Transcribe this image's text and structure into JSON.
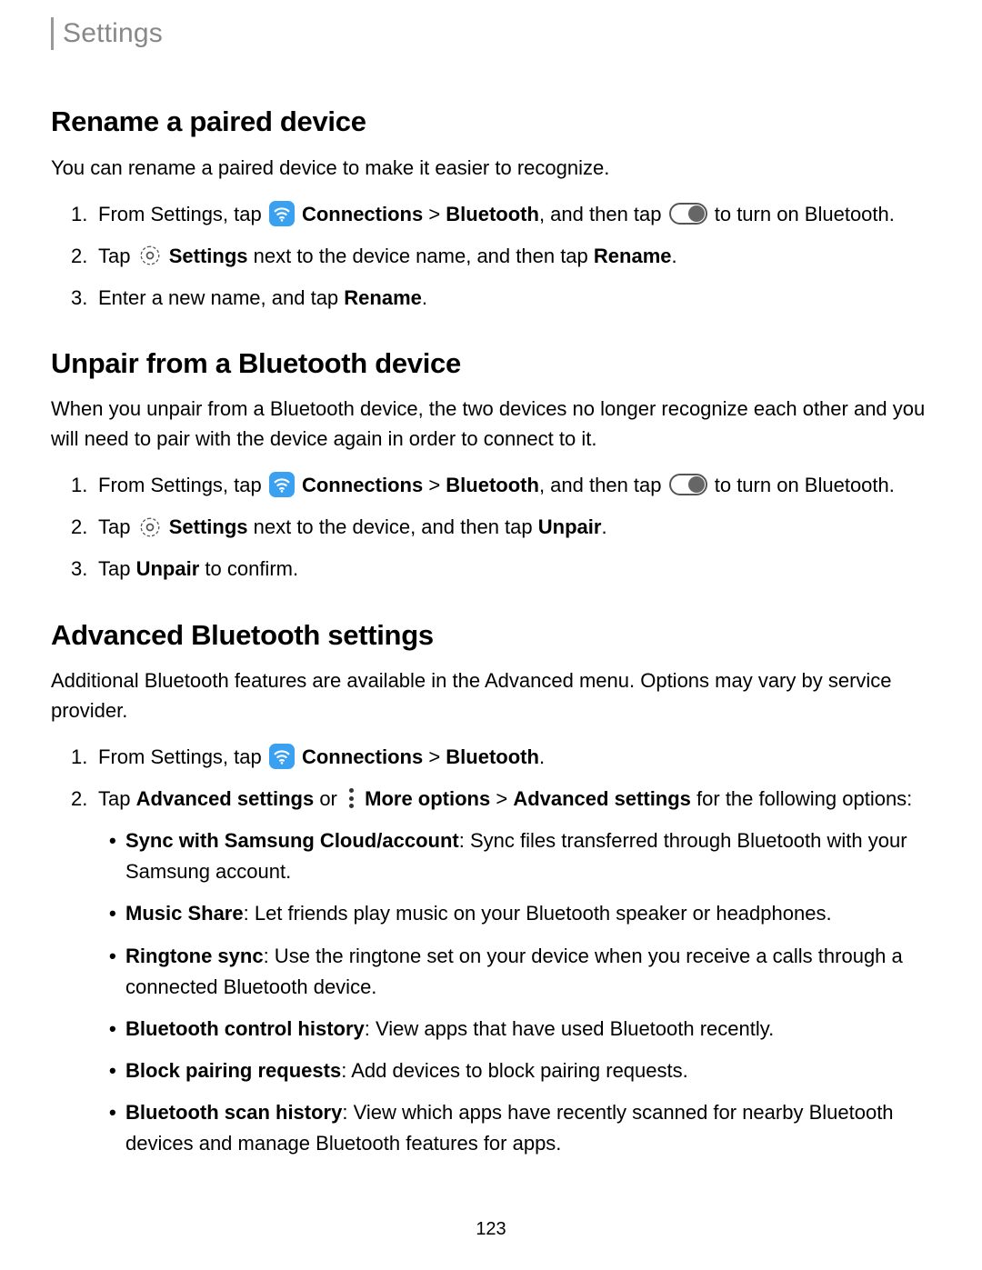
{
  "header": {
    "title": "Settings"
  },
  "section1": {
    "heading": "Rename a paired device",
    "lead": "You can rename a paired device to make it easier to recognize.",
    "step1_a": "From Settings, tap ",
    "step1_conn": "Connections",
    "step1_sep": " > ",
    "step1_bt": "Bluetooth",
    "step1_b": ", and then tap ",
    "step1_c": " to turn on Bluetooth.",
    "step2_a": "Tap ",
    "step2_set": "Settings",
    "step2_b": " next to the device name, and then tap ",
    "step2_ren": "Rename",
    "step2_c": ".",
    "step3_a": "Enter a new name, and tap ",
    "step3_ren": "Rename",
    "step3_b": "."
  },
  "section2": {
    "heading": "Unpair from a Bluetooth device",
    "lead": "When you unpair from a Bluetooth device, the two devices no longer recognize each other and you will need to pair with the device again in order to connect to it.",
    "step1_a": "From Settings, tap ",
    "step1_conn": "Connections",
    "step1_sep": " > ",
    "step1_bt": "Bluetooth",
    "step1_b": ", and then tap ",
    "step1_c": " to turn on Bluetooth.",
    "step2_a": "Tap ",
    "step2_set": "Settings",
    "step2_b": " next to the device, and then tap ",
    "step2_un": "Unpair",
    "step2_c": ".",
    "step3_a": "Tap ",
    "step3_un": "Unpair",
    "step3_b": " to confirm."
  },
  "section3": {
    "heading": "Advanced Bluetooth settings",
    "lead": "Additional Bluetooth features are available in the Advanced menu. Options may vary by service provider.",
    "step1_a": "From Settings, tap ",
    "step1_conn": "Connections",
    "step1_sep": " > ",
    "step1_bt": "Bluetooth",
    "step1_b": ".",
    "step2_a": "Tap ",
    "step2_adv": "Advanced settings",
    "step2_b": " or ",
    "step2_more": "More options",
    "step2_sep": " > ",
    "step2_adv2": "Advanced settings",
    "step2_c": " for the following options:",
    "bullets": [
      {
        "bold": "Sync with Samsung Cloud/account",
        "rest": ": Sync files transferred through Bluetooth with your Samsung account."
      },
      {
        "bold": "Music Share",
        "rest": ": Let friends play music on your Bluetooth speaker or headphones."
      },
      {
        "bold": "Ringtone sync",
        "rest": ": Use the ringtone set on your device when you receive a calls through a connected Bluetooth device."
      },
      {
        "bold": "Bluetooth control history",
        "rest": ": View apps that have used Bluetooth recently."
      },
      {
        "bold": "Block pairing requests",
        "rest": ": Add devices to block pairing requests."
      },
      {
        "bold": "Bluetooth scan history",
        "rest": ": View which apps have recently scanned for nearby Bluetooth devices and manage Bluetooth features for apps."
      }
    ]
  },
  "page_number": "123"
}
